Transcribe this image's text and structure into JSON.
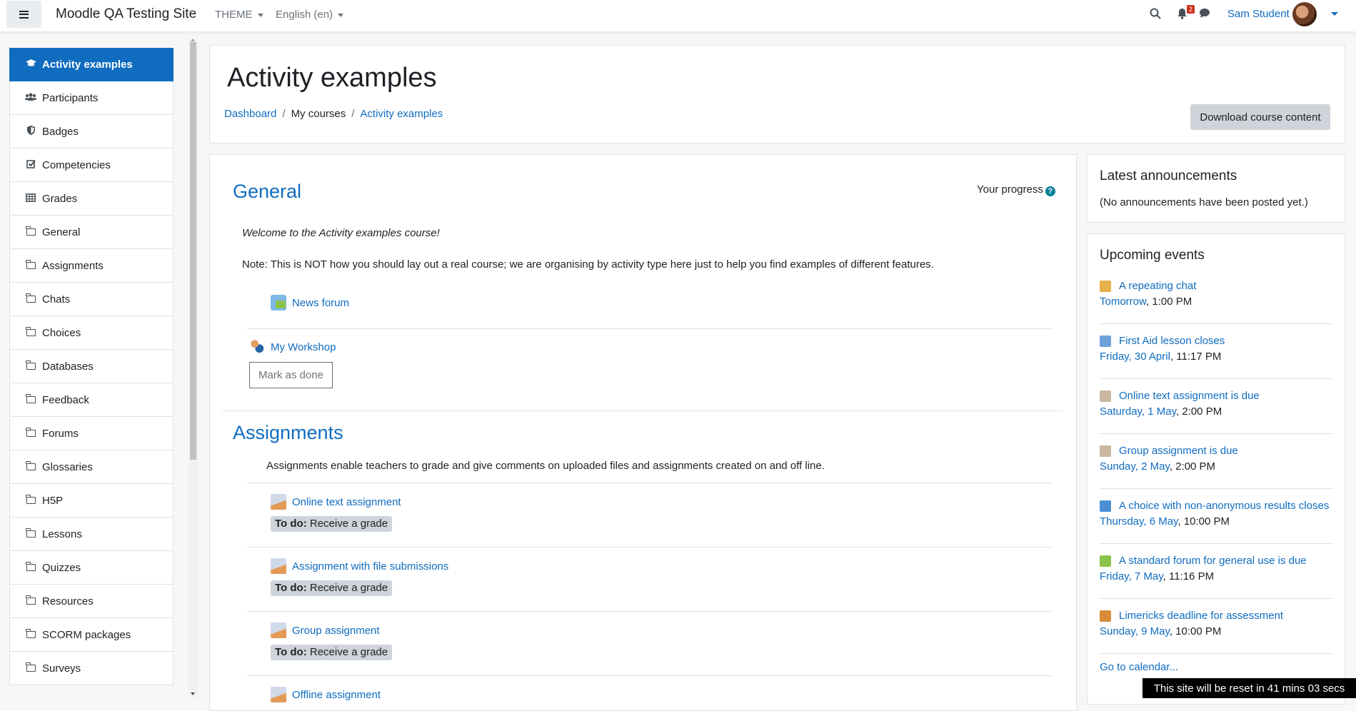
{
  "topbar": {
    "site_name": "Moodle QA Testing Site",
    "menus": [
      "THEME",
      "English (en)"
    ],
    "notification_count": "2",
    "user_name": "Sam Student"
  },
  "sidebar": {
    "items": [
      {
        "label": "Activity examples",
        "icon": "graduation-cap-icon",
        "active": true
      },
      {
        "label": "Participants",
        "icon": "users-icon"
      },
      {
        "label": "Badges",
        "icon": "shield-icon"
      },
      {
        "label": "Competencies",
        "icon": "check-square-icon"
      },
      {
        "label": "Grades",
        "icon": "table-icon"
      },
      {
        "label": "General",
        "icon": "folder-icon"
      },
      {
        "label": "Assignments",
        "icon": "folder-icon"
      },
      {
        "label": "Chats",
        "icon": "folder-icon"
      },
      {
        "label": "Choices",
        "icon": "folder-icon"
      },
      {
        "label": "Databases",
        "icon": "folder-icon"
      },
      {
        "label": "Feedback",
        "icon": "folder-icon"
      },
      {
        "label": "Forums",
        "icon": "folder-icon"
      },
      {
        "label": "Glossaries",
        "icon": "folder-icon"
      },
      {
        "label": "H5P",
        "icon": "folder-icon"
      },
      {
        "label": "Lessons",
        "icon": "folder-icon"
      },
      {
        "label": "Quizzes",
        "icon": "folder-icon"
      },
      {
        "label": "Resources",
        "icon": "folder-icon"
      },
      {
        "label": "SCORM packages",
        "icon": "folder-icon"
      },
      {
        "label": "Surveys",
        "icon": "folder-icon"
      }
    ]
  },
  "header": {
    "title": "Activity examples",
    "breadcrumbs": [
      "Dashboard",
      "My courses",
      "Activity examples"
    ],
    "download_label": "Download course content"
  },
  "main": {
    "general": {
      "title": "General",
      "progress_label": "Your progress",
      "welcome": "Welcome to the Activity examples course!",
      "note": "Note: This is NOT how you should lay out a real course; we are organising by activity type here just to help you find examples of different features.",
      "forum": "News forum",
      "workshop": "My Workshop",
      "mark_done": "Mark as done"
    },
    "assignments": {
      "title": "Assignments",
      "summary": "Assignments enable teachers to grade and give comments on uploaded files and assignments created on and off line.",
      "todo_prefix": "To do:",
      "todo_text": "Receive a grade",
      "items": [
        "Online text assignment",
        "Assignment with file submissions",
        "Group assignment",
        "Offline assignment"
      ]
    }
  },
  "blocks": {
    "announcements": {
      "title": "Latest announcements",
      "empty": "(No announcements have been posted yet.)"
    },
    "events": {
      "title": "Upcoming events",
      "items": [
        {
          "name": "A repeating chat",
          "date": "Tomorrow",
          "time": ", 1:00 PM",
          "icon": "chat-icon",
          "color": "#e8b04a"
        },
        {
          "name": "First Aid lesson closes",
          "date": "Friday, 30 April",
          "time": ", 11:17 PM",
          "icon": "lesson-icon",
          "color": "#6fa0d8"
        },
        {
          "name": "Online text assignment is due",
          "date": "Saturday, 1 May",
          "time": ", 2:00 PM",
          "icon": "assignment-icon",
          "color": "#c9b7a0"
        },
        {
          "name": "Group assignment is due",
          "date": "Sunday, 2 May",
          "time": ", 2:00 PM",
          "icon": "assignment-icon",
          "color": "#c9b7a0"
        },
        {
          "name": "A choice with non-anonymous results closes",
          "date": "Thursday, 6 May",
          "time": ", 10:00 PM",
          "icon": "choice-icon",
          "color": "#4a8fd6"
        },
        {
          "name": "A standard forum for general use is due",
          "date": "Friday, 7 May",
          "time": ", 11:16 PM",
          "icon": "forum-icon",
          "color": "#8bc34a"
        },
        {
          "name": "Limericks deadline for assessment",
          "date": "Sunday, 9 May",
          "time": ", 10:00 PM",
          "icon": "workshop-icon",
          "color": "#d98b3a"
        }
      ],
      "calendar_link": "Go to calendar..."
    }
  },
  "reset_notice": "This site will be reset in 41 mins 03 secs"
}
